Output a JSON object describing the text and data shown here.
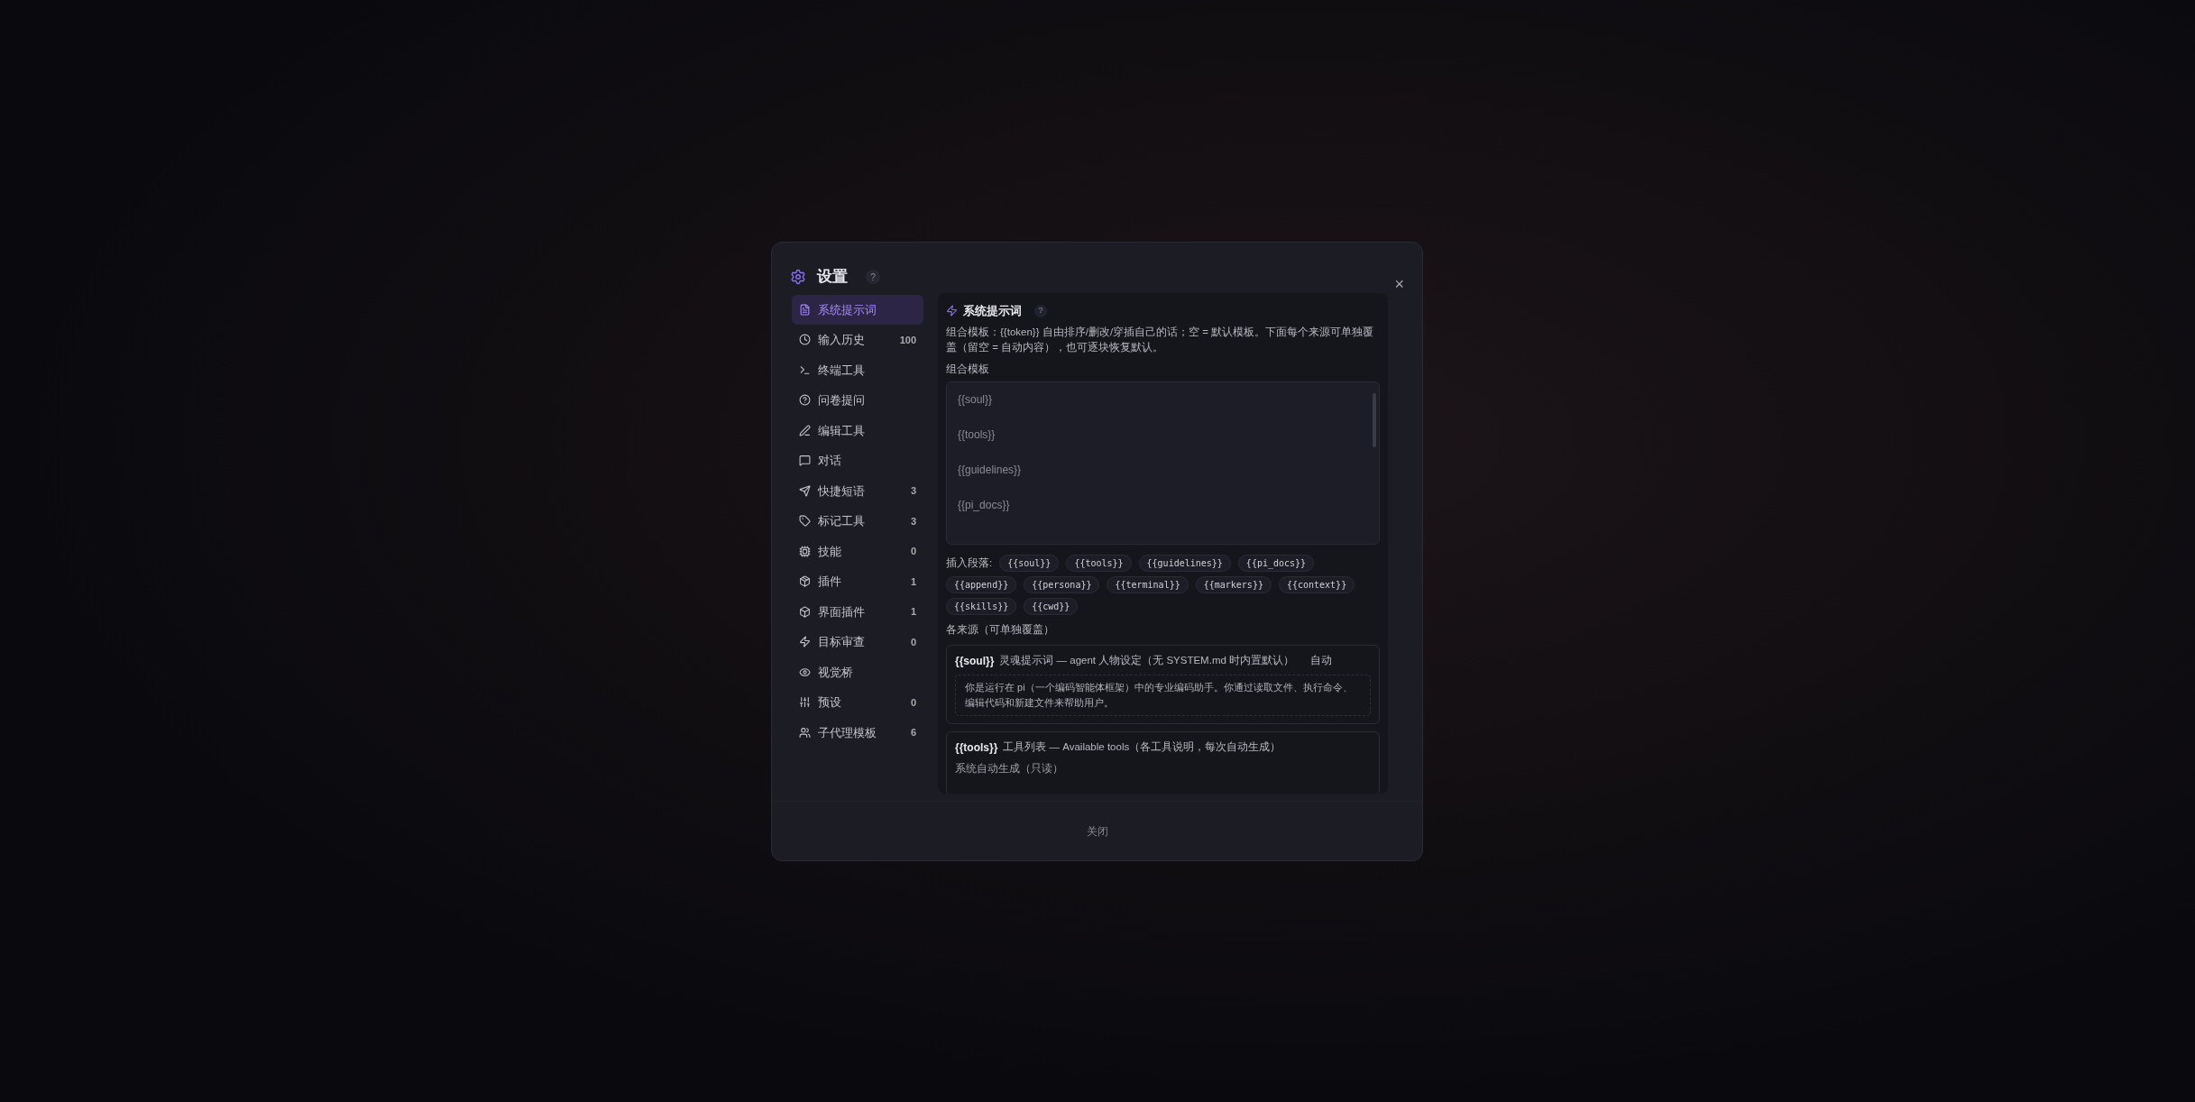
{
  "dialog": {
    "title": "设置",
    "help": "?",
    "close": "×",
    "nav": [
      {
        "label": "系统提示词",
        "selected": true
      },
      {
        "label": "输入历史",
        "count": "100",
        "selected": false
      },
      {
        "label": "终端工具",
        "selected": false
      },
      {
        "label": "问卷提问",
        "selected": false
      },
      {
        "label": "编辑工具",
        "selected": false
      },
      {
        "label": "对话",
        "selected": false
      },
      {
        "label": "快捷短语",
        "count": "3",
        "selected": false
      },
      {
        "label": "标记工具",
        "count": "3",
        "selected": false
      },
      {
        "label": "技能",
        "count": "0",
        "selected": false
      },
      {
        "label": "插件",
        "count": "1",
        "selected": false
      },
      {
        "label": "界面插件",
        "count": "1",
        "selected": false
      },
      {
        "label": "目标审查",
        "count": "0",
        "selected": false
      },
      {
        "label": "视觉桥",
        "selected": false
      },
      {
        "label": "预设",
        "count": "0",
        "selected": false
      },
      {
        "label": "子代理模板",
        "count": "6",
        "selected": false
      }
    ],
    "section": {
      "title": "系统提示词",
      "help": "?",
      "description": "组合模板：{{token}} 自由排序/删改/穿插自己的话；空 = 默认模板。下面每个来源可单独覆盖（留空 = 自动内容），也可逐块恢复默认。",
      "template_label": "组合模板",
      "template_lines": [
        "{{soul}}",
        "{{tools}}",
        "{{guidelines}}",
        "{{pi_docs}}"
      ],
      "insert_label": "插入段落:",
      "insert_tokens": [
        "{{soul}}",
        "{{tools}}",
        "{{guidelines}}",
        "{{pi_docs}}",
        "{{append}}",
        "{{persona}}",
        "{{terminal}}",
        "{{markers}}",
        "{{context}}",
        "{{skills}}",
        "{{cwd}}"
      ],
      "sources_label": "各来源（可单独覆盖）",
      "sources": [
        {
          "token": "{{soul}}",
          "description": "灵魂提示词 — agent 人物设定（无 SYSTEM.md 时内置默认）",
          "mode": "自动",
          "kind": "editable",
          "content": "你是运行在 pi（一个编码智能体框架）中的专业编码助手。你通过读取文件、执行命令、编辑代码和新建文件来帮助用户。"
        },
        {
          "token": "{{tools}}",
          "description": "工具列表 — Available tools（各工具说明，每次自动生成）",
          "kind": "readonly",
          "content": "系统自动生成（只读）"
        }
      ]
    },
    "footer_button": "关闭"
  }
}
